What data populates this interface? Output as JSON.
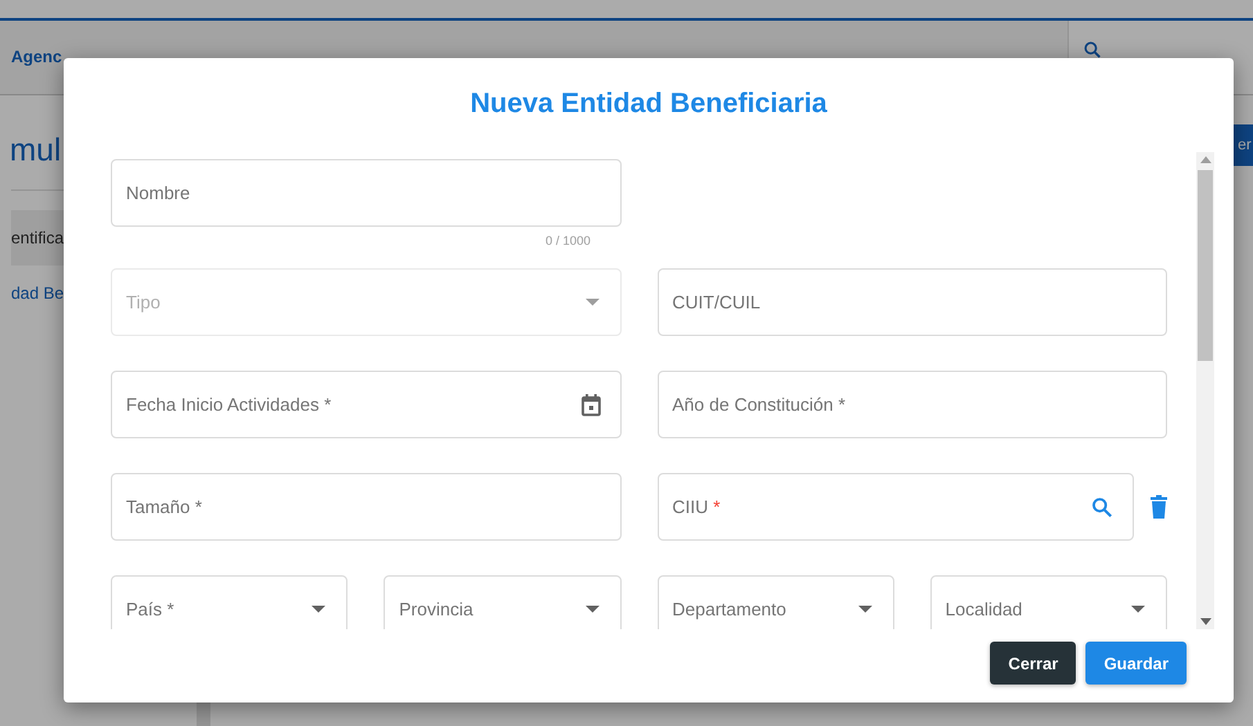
{
  "background": {
    "brand": "Agenc",
    "heading": "mul",
    "side_items": [
      {
        "label": "entifica",
        "selected": true
      },
      {
        "label": "dad Be",
        "selected": false
      }
    ],
    "button": "er"
  },
  "dialog": {
    "title": "Nueva Entidad Beneficiaria",
    "rows": [
      {
        "fields": [
          {
            "kind": "text",
            "label": "Nombre",
            "counter": "0 / 1000",
            "disabled": false
          }
        ]
      },
      {
        "fields": [
          {
            "kind": "select",
            "label": "Tipo",
            "disabled": true
          },
          {
            "kind": "text",
            "label": "CUIT/CUIL",
            "disabled": false
          }
        ]
      },
      {
        "fields": [
          {
            "kind": "date",
            "label": "Fecha Inicio Actividades *",
            "disabled": false
          },
          {
            "kind": "text",
            "label": "Año de Constitución *",
            "disabled": false
          }
        ]
      },
      {
        "fields": [
          {
            "kind": "text",
            "label": "Tamaño *",
            "disabled": false
          },
          {
            "kind": "lookup",
            "label": "CIIU",
            "required_mark": "*",
            "disabled": false
          }
        ]
      },
      {
        "fields": [
          {
            "kind": "select",
            "label": "País *",
            "disabled": false
          },
          {
            "kind": "select",
            "label": "Provincia",
            "disabled": false
          },
          {
            "kind": "select",
            "label": "Departamento",
            "disabled": false
          },
          {
            "kind": "select",
            "label": "Localidad",
            "disabled": false
          }
        ]
      }
    ],
    "buttons": [
      {
        "kind": "secondary",
        "label": "Cerrar"
      },
      {
        "kind": "primary",
        "label": "Guardar"
      }
    ]
  }
}
